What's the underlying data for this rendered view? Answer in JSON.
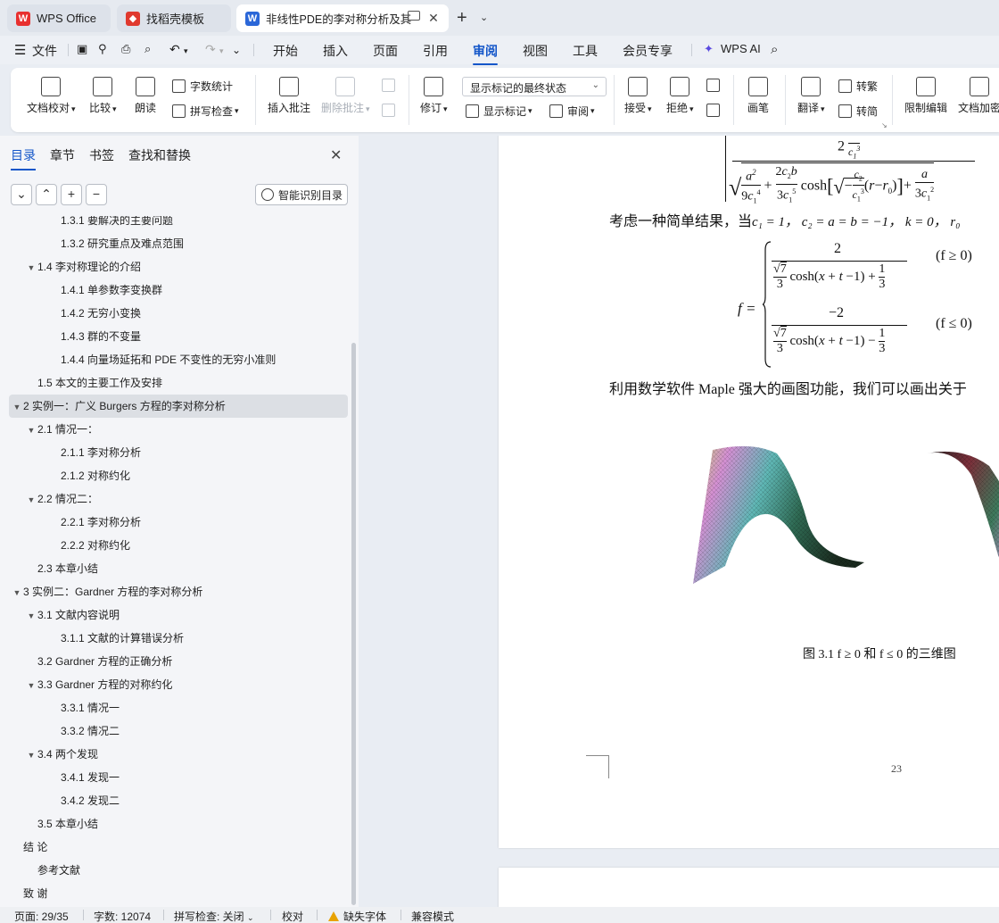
{
  "tabs": [
    {
      "label": "WPS Office"
    },
    {
      "label": "找稻壳模板"
    },
    {
      "label": "非线性PDE的李对称分析及其"
    }
  ],
  "menu": {
    "file": "文件",
    "items": [
      "开始",
      "插入",
      "页面",
      "引用",
      "审阅",
      "视图",
      "工具",
      "会员专享"
    ],
    "wps_ai": "WPS AI"
  },
  "ribbon": {
    "doc_check": "文档校对",
    "compare": "比较",
    "read_aloud": "朗读",
    "word_count": "字数统计",
    "spell_check": "拼写检查",
    "insert_comment": "插入批注",
    "delete_comment": "删除批注",
    "revise": "修订",
    "markup_state": "显示标记的最终状态",
    "show_markup": "显示标记",
    "review": "审阅",
    "accept": "接受",
    "reject": "拒绝",
    "pen": "画笔",
    "translate": "翻译",
    "to_traditional": "转繁",
    "to_simplified": "转简",
    "restrict_edit": "限制编辑",
    "doc_encrypt": "文档加密"
  },
  "panel": {
    "tabs": [
      "目录",
      "章节",
      "书签",
      "查找和替换"
    ],
    "smart_toc": "智能识别目录",
    "toc": [
      {
        "text": "1.3.1  要解决的主要问题",
        "level": 3,
        "arrow": ""
      },
      {
        "text": "1.3.2  研究重点及难点范围",
        "level": 3,
        "arrow": ""
      },
      {
        "text": "1.4  李对称理论的介绍",
        "level": 2,
        "arrow": "▼"
      },
      {
        "text": "1.4.1  单参数李变换群",
        "level": 3,
        "arrow": ""
      },
      {
        "text": "1.4.2  无穷小变换",
        "level": 3,
        "arrow": ""
      },
      {
        "text": "1.4.3  群的不变量",
        "level": 3,
        "arrow": ""
      },
      {
        "text": "1.4.4  向量场延拓和 PDE 不变性的无穷小准则",
        "level": 3,
        "arrow": ""
      },
      {
        "text": "1.5  本文的主要工作及安排",
        "level": 2,
        "arrow": ""
      },
      {
        "text": "2  实例一：广义 Burgers 方程的李对称分析",
        "level": 1,
        "arrow": "▼",
        "selected": true
      },
      {
        "text": "2.1  情况一：",
        "level": 2,
        "arrow": "▼"
      },
      {
        "text": "2.1.1  李对称分析",
        "level": 3,
        "arrow": ""
      },
      {
        "text": "2.1.2  对称约化",
        "level": 3,
        "arrow": ""
      },
      {
        "text": "2.2  情况二：",
        "level": 2,
        "arrow": "▼"
      },
      {
        "text": "2.2.1  李对称分析",
        "level": 3,
        "arrow": ""
      },
      {
        "text": "2.2.2  对称约化",
        "level": 3,
        "arrow": ""
      },
      {
        "text": "2.3  本章小结",
        "level": 2,
        "arrow": ""
      },
      {
        "text": "3  实例二：Gardner 方程的李对称分析",
        "level": 1,
        "arrow": "▼"
      },
      {
        "text": "3.1  文献内容说明",
        "level": 2,
        "arrow": "▼"
      },
      {
        "text": "3.1.1  文献的计算错误分析",
        "level": 3,
        "arrow": ""
      },
      {
        "text": "3.2 Gardner 方程的正确分析",
        "level": 2,
        "arrow": ""
      },
      {
        "text": "3.3 Gardner 方程的对称约化",
        "level": 2,
        "arrow": "▼"
      },
      {
        "text": "3.3.1  情况一",
        "level": 3,
        "arrow": ""
      },
      {
        "text": "3.3.2  情况二",
        "level": 3,
        "arrow": ""
      },
      {
        "text": "3.4  两个发现",
        "level": 2,
        "arrow": "▼"
      },
      {
        "text": "3.4.1  发现一",
        "level": 3,
        "arrow": ""
      },
      {
        "text": "3.4.2  发现二",
        "level": 3,
        "arrow": ""
      },
      {
        "text": "3.5  本章小结",
        "level": 2,
        "arrow": ""
      },
      {
        "text": "结  论",
        "level": 1,
        "arrow": ""
      },
      {
        "text": "参考文献",
        "level": 2,
        "arrow": ""
      },
      {
        "text": "致  谢",
        "level": 1,
        "arrow": ""
      }
    ]
  },
  "document": {
    "para1": "考虑一种简单结果，当",
    "para1_math": "c₁ = 1，  c₂ = a = b = −1，  k = 0，  r₀",
    "eq_top_num": "2",
    "eq_bot_num": "−2",
    "eq_cond1": "(f ≥ 0)",
    "eq_cond2": "(f ≤ 0)",
    "para2": "利用数学软件 Maple 强大的画图功能，我们可以画出关于",
    "caption": "图 3.1   f ≥ 0 和 f ≤ 0 的三维图",
    "page_number": "23"
  },
  "status": {
    "page": "页面: 29/35",
    "words": "字数: 12074",
    "spell": "拼写检查: 关闭",
    "proof": "校对",
    "missing_font": "缺失字体",
    "compat": "兼容模式"
  }
}
